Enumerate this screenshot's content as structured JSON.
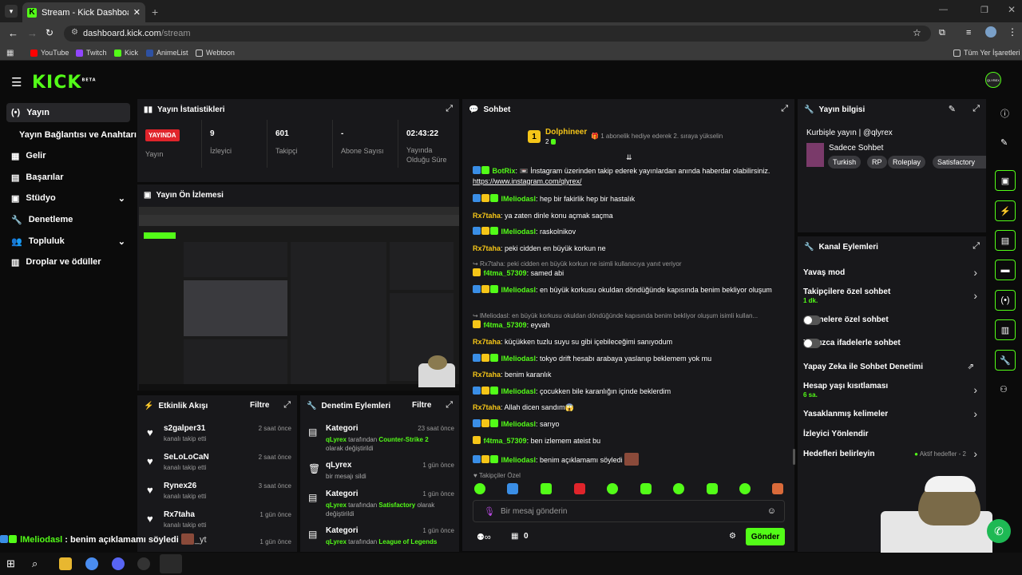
{
  "browser": {
    "tab_title": "Stream - Kick Dashboard",
    "url_domain": "dashboard.kick.com",
    "url_path": "/stream",
    "bookmarks": [
      "YouTube",
      "Twitch",
      "Kick",
      "AnimeList",
      "Webtoon"
    ],
    "bookmarks_right": "Tüm Yer İşaretleri"
  },
  "app": {
    "logo": "KICK",
    "logo_beta": "BETA",
    "user_avatar": "QLYREX"
  },
  "sidebar": {
    "items": [
      {
        "label": "Yayın",
        "icon": "broadcast-icon"
      },
      {
        "label": "Yayın Bağlantısı ve Anahtarı",
        "icon": ""
      },
      {
        "label": "Gelir",
        "icon": "revenue-icon"
      },
      {
        "label": "Başarılar",
        "icon": "achievements-icon"
      },
      {
        "label": "Stüdyo",
        "icon": "studio-icon"
      },
      {
        "label": "Denetleme",
        "icon": "wrench-icon"
      },
      {
        "label": "Topluluk",
        "icon": "people-icon"
      },
      {
        "label": "Droplar ve ödüller",
        "icon": "gift-icon"
      }
    ]
  },
  "stats": {
    "title": "Yayın İstatistikleri",
    "live_badge": "YAYINDA",
    "live_label": "Yayın",
    "viewers_value": "9",
    "viewers_label": "İzleyici",
    "followers_value": "601",
    "followers_label": "Takipçi",
    "subs_value": "-",
    "subs_label": "Abone Sayısı",
    "uptime_value": "02:43:22",
    "uptime_label": "Yayında Olduğu Süre"
  },
  "preview": {
    "title": "Yayın Ön İzlemesi"
  },
  "activity": {
    "title": "Etkinlik Akışı",
    "filter": "Filtre",
    "items": [
      {
        "name": "s2galper31",
        "action": "kanalı takip etti",
        "time": "2 saat önce"
      },
      {
        "name": "SeLoLoCaN",
        "action": "kanalı takip etti",
        "time": "2 saat önce"
      },
      {
        "name": "Rynex26",
        "action": "kanalı takip etti",
        "time": "3 saat önce"
      },
      {
        "name": "Rx7taha",
        "action": "kanalı takip etti",
        "time": "1 gün önce"
      },
      {
        "name": "",
        "action": "",
        "time": "1 gün önce"
      }
    ]
  },
  "moderation": {
    "title": "Denetim Eylemleri",
    "filter": "Filtre",
    "items": [
      {
        "title": "Kategori",
        "time": "23 saat önce",
        "actor": "qLyrex",
        "middle": " tarafından ",
        "target": "Counter-Strike 2",
        "end": " olarak değiştirildi"
      },
      {
        "title": "qLyrex",
        "time": "1 gün önce",
        "actor": "",
        "middle": "bir mesajı sildi",
        "target": "",
        "end": ""
      },
      {
        "title": "Kategori",
        "time": "1 gün önce",
        "actor": "qLyrex",
        "middle": " tarafından ",
        "target": "Satisfactory",
        "end": " olarak değiştirildi"
      },
      {
        "title": "Kategori",
        "time": "1 gün önce",
        "actor": "qLyrex",
        "middle": " tarafından ",
        "target": "League of Legends",
        "end": ""
      }
    ]
  },
  "chat": {
    "title": "Sohbet",
    "pinned_user": "Dolphineer",
    "pinned_rank": "1",
    "pinned_count": "2",
    "pinned_text": "1 abonelik hediye ederek 2. sıraya yükselin",
    "messages": [
      {
        "user": "BotRix",
        "color": "#53fc18",
        "text": " 📼 İnstagram üzerinden takip ederek yayınlardan anında haberdar olabilirsiniz.",
        "link": "https://www.instagram.com/qlyrex/",
        "reply": ""
      },
      {
        "user": "lMeliodasl",
        "color": "#53fc18",
        "text": "hep bir fakirlik hep bir hastalık",
        "link": "",
        "reply": ""
      },
      {
        "user": "Rx7taha",
        "color": "#f5c518",
        "text": "ya zaten dinle konu açmak saçma",
        "link": "",
        "reply": ""
      },
      {
        "user": "lMeliodasl",
        "color": "#53fc18",
        "text": "raskolnikov",
        "link": "",
        "reply": ""
      },
      {
        "user": "Rx7taha",
        "color": "#f5c518",
        "text": "peki cidden en büyük korkun ne",
        "link": "",
        "reply": ""
      },
      {
        "user": "f4tma_57309",
        "color": "#53fc18",
        "text": "samed abi",
        "link": "",
        "reply": "Rx7taha: peki cidden en büyük korkun ne isimli kullanıcıya yanıt veriyor"
      },
      {
        "user": "lMeliodasl",
        "color": "#53fc18",
        "text": "en büyük korkusu okuldan döndüğünde kapısında benim bekliyor oluşum",
        "link": "",
        "reply": ""
      },
      {
        "user": "f4tma_57309",
        "color": "#53fc18",
        "text": "eyvah",
        "link": "",
        "reply": "lMeliodasl: en büyük korkusu okuldan döndüğünde kapısında benim bekliyor oluşum isimli kullan..."
      },
      {
        "user": "Rx7taha",
        "color": "#f5c518",
        "text": "küçükken tuzlu suyu su gibi içebileceğimi sanıyodum",
        "link": "",
        "reply": ""
      },
      {
        "user": "lMeliodasl",
        "color": "#53fc18",
        "text": "tokyo drift hesabı arabaya yaslanıp beklemem yok mu",
        "link": "",
        "reply": ""
      },
      {
        "user": "Rx7taha",
        "color": "#f5c518",
        "text": "benim karanlık",
        "link": "",
        "reply": ""
      },
      {
        "user": "lMeliodasl",
        "color": "#53fc18",
        "text": "çocukken bile karanlığın içinde beklerdim",
        "link": "",
        "reply": ""
      },
      {
        "user": "Rx7taha",
        "color": "#f5c518",
        "text": "Allah dicen sandım😱",
        "link": "",
        "reply": ""
      },
      {
        "user": "lMeliodasl",
        "color": "#53fc18",
        "text": "sarıyo",
        "link": "",
        "reply": ""
      },
      {
        "user": "f4tma_57309",
        "color": "#53fc18",
        "text": "ben izlemem ateist bu",
        "link": "",
        "reply": ""
      },
      {
        "user": "lMeliodasl",
        "color": "#53fc18",
        "text": "benim açıklamamı söyledi",
        "link": "",
        "reply": ""
      }
    ],
    "emote_section": "Takipçiler Özel",
    "input_placeholder": "Bir mesaj gönderin",
    "points": "0",
    "send": "Gönder"
  },
  "stream_info": {
    "title": "Yayın bilgisi",
    "stream_title": "Kurbişle yayın | @qlyrex",
    "category": "Sadece Sohbet",
    "tags": [
      "Turkish",
      "RP",
      "Roleplay",
      "Satisfactory"
    ]
  },
  "channel_actions": {
    "title": "Kanal Eylemleri",
    "items": [
      {
        "label": "Yavaş mod",
        "sub": "",
        "control": "chevron"
      },
      {
        "label": "Takipçilere özel sohbet",
        "sub": "1 dk.",
        "control": "chevron"
      },
      {
        "label": "Abonelere özel sohbet",
        "sub": "",
        "control": "toggle"
      },
      {
        "label": "Yalnızca ifadelerle sohbet",
        "sub": "",
        "control": "toggle"
      },
      {
        "label": "Yapay Zeka ile Sohbet Denetimi",
        "sub": "",
        "control": "external"
      },
      {
        "label": "Hesap yaşı kısıtlaması",
        "sub": "6 sa.",
        "control": "chevron"
      },
      {
        "label": "Yasaklanmış kelimeler",
        "sub": "",
        "control": "chevron"
      },
      {
        "label": "İzleyici Yönlendir",
        "sub": "",
        "control": "none"
      },
      {
        "label": "Hedefleri belirleyin",
        "sub": "",
        "control": "chevron"
      }
    ],
    "goals_status": "Aktif hedefler - 2"
  },
  "overlay": {
    "user": "lMeliodasl",
    "text": " : benim açıklamamı söyledi",
    "extra": "_yt"
  }
}
